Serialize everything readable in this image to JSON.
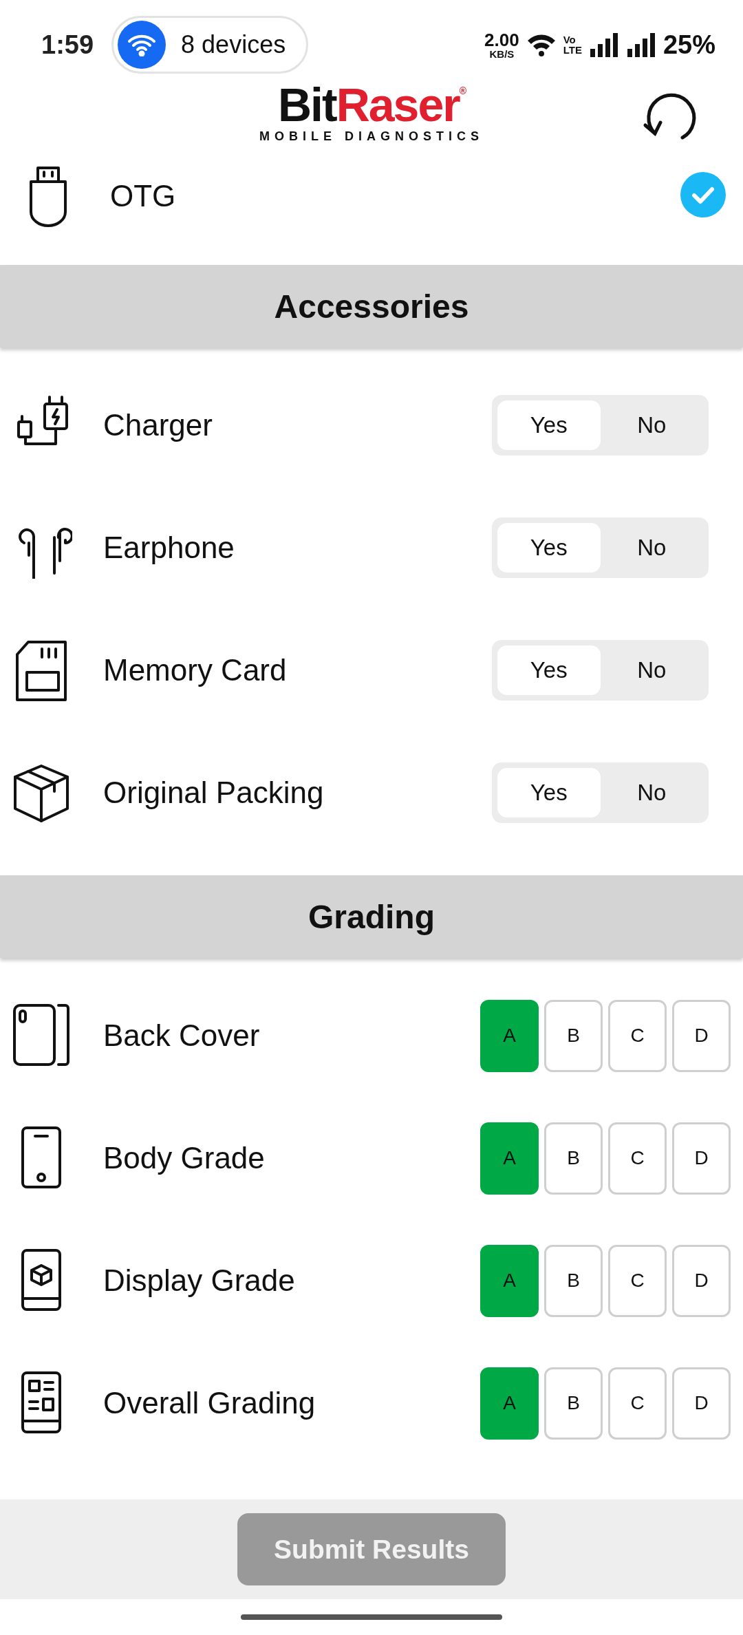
{
  "status_bar": {
    "time": "1:59",
    "hotspot": "8 devices",
    "speed": "2.00",
    "speed_unit": "KB/S",
    "volte_top": "Vo",
    "volte_bottom": "LTE",
    "battery": "25%"
  },
  "logo": {
    "part_1": "Bit",
    "part_2": "Raser",
    "mark": "®",
    "tagline": "MOBILE DIAGNOSTICS"
  },
  "otg": {
    "label": "OTG",
    "checked": true
  },
  "accessories": {
    "title": "Accessories",
    "items": [
      {
        "kind": "charger",
        "label": "Charger",
        "options": [
          {
            "label": "Yes",
            "selected": true
          },
          {
            "label": "No",
            "selected": false
          }
        ]
      },
      {
        "kind": "earphone",
        "label": "Earphone",
        "options": [
          {
            "label": "Yes",
            "selected": true
          },
          {
            "label": "No",
            "selected": false
          }
        ]
      },
      {
        "kind": "memory-card",
        "label": "Memory Card",
        "options": [
          {
            "label": "Yes",
            "selected": true
          },
          {
            "label": "No",
            "selected": false
          }
        ]
      },
      {
        "kind": "box",
        "label": "Original Packing",
        "options": [
          {
            "label": "Yes",
            "selected": true
          },
          {
            "label": "No",
            "selected": false
          }
        ]
      }
    ]
  },
  "grading": {
    "title": "Grading",
    "items": [
      {
        "kind": "back-cover",
        "label": "Back Cover",
        "grades": [
          {
            "label": "A",
            "selected": true
          },
          {
            "label": "B",
            "selected": false
          },
          {
            "label": "C",
            "selected": false
          },
          {
            "label": "D",
            "selected": false
          }
        ]
      },
      {
        "kind": "phone",
        "label": "Body Grade",
        "grades": [
          {
            "label": "A",
            "selected": true
          },
          {
            "label": "B",
            "selected": false
          },
          {
            "label": "C",
            "selected": false
          },
          {
            "label": "D",
            "selected": false
          }
        ]
      },
      {
        "kind": "display",
        "label": "Display Grade",
        "grades": [
          {
            "label": "A",
            "selected": true
          },
          {
            "label": "B",
            "selected": false
          },
          {
            "label": "C",
            "selected": false
          },
          {
            "label": "D",
            "selected": false
          }
        ]
      },
      {
        "kind": "overall",
        "label": "Overall Grading",
        "grades": [
          {
            "label": "A",
            "selected": true
          },
          {
            "label": "B",
            "selected": false
          },
          {
            "label": "C",
            "selected": false
          },
          {
            "label": "D",
            "selected": false
          }
        ]
      }
    ]
  },
  "submit": {
    "label": "Submit Results",
    "disabled": true
  }
}
